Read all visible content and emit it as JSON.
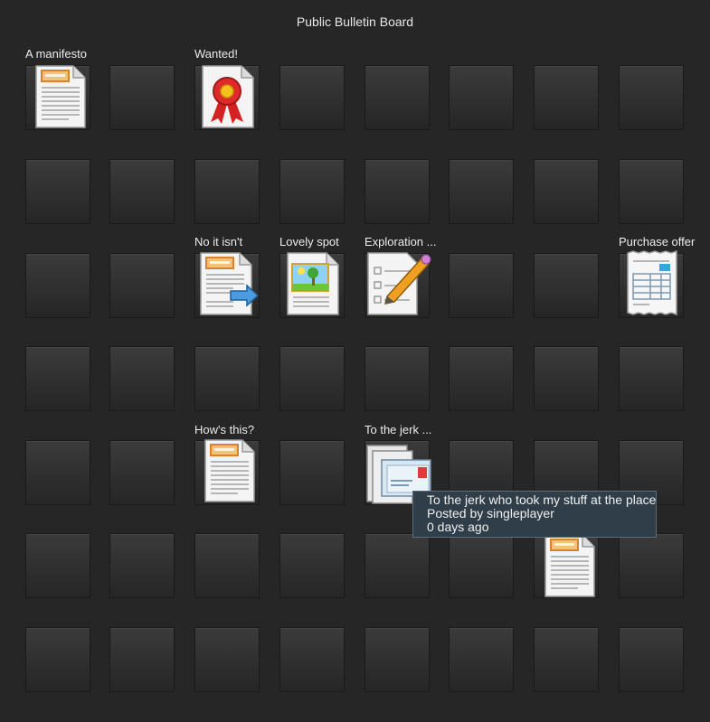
{
  "board": {
    "title": "Public Bulletin Board"
  },
  "notes": [
    {
      "id": "manifesto",
      "label": "A manifesto",
      "icon": "document-icon"
    },
    {
      "id": "wanted",
      "label": "Wanted!",
      "icon": "award-ribbon-document-icon"
    },
    {
      "id": "no-it-isnt",
      "label": "No it isn't",
      "icon": "document-reply-arrow-icon"
    },
    {
      "id": "lovely-spot",
      "label": "Lovely spot",
      "icon": "picture-document-icon"
    },
    {
      "id": "exploration",
      "label": "Exploration ...",
      "icon": "checklist-pencil-icon"
    },
    {
      "id": "purchase-offer",
      "label": "Purchase offer",
      "icon": "receipt-icon"
    },
    {
      "id": "hows-this",
      "label": "How's this?",
      "icon": "document-icon"
    },
    {
      "id": "to-the-jerk",
      "label": "To the jerk ...",
      "icon": "letter-stack-icon"
    },
    {
      "id": "unlabeled-note",
      "label": "",
      "icon": "document-icon"
    }
  ],
  "tooltip": {
    "title": "To the jerk who took my stuff at the place",
    "posted_by": "Posted by singleplayer",
    "age": "0 days ago"
  },
  "colors": {
    "background": "#262626",
    "slot": "#333333",
    "tooltip_bg": "#2f3e49",
    "tooltip_border": "#5c6d78"
  }
}
